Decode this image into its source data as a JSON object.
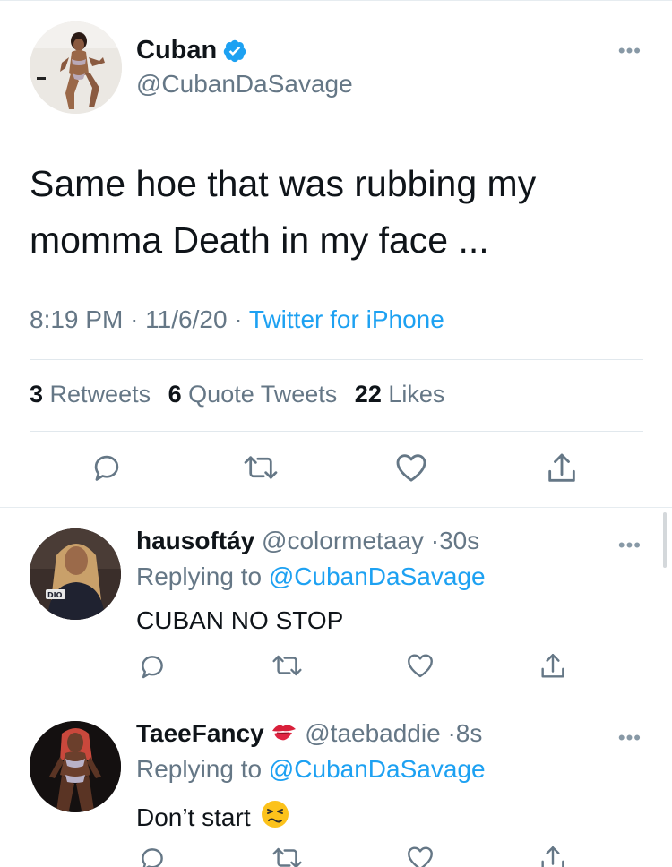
{
  "main_tweet": {
    "display_name": "Cuban",
    "handle": "@CubanDaSavage",
    "verified_icon": "verified-badge-icon",
    "text": "Same hoe that was rubbing my momma Death in my face ...",
    "time": "8:19 PM",
    "date": "11/6/20",
    "source": "Twitter for iPhone",
    "stats": {
      "retweets_count": "3",
      "retweets_label": "Retweets",
      "quotes_count": "6",
      "quotes_label": "Quote Tweets",
      "likes_count": "22",
      "likes_label": "Likes"
    },
    "actions": [
      "reply-icon",
      "retweet-icon",
      "like-icon",
      "share-icon"
    ]
  },
  "replies": [
    {
      "display_name": "hausoftáy",
      "handle": "@colormetaay",
      "time": "30s",
      "replying_prefix": "Replying to",
      "replying_to": "@CubanDaSavage",
      "text": "CUBAN NO STOP"
    },
    {
      "display_name": "TaeeFancy",
      "name_emoji": "kiss-mark-emoji",
      "handle": "@taebaddie",
      "time": "8s",
      "replying_prefix": "Replying to",
      "replying_to": "@CubanDaSavage",
      "text": "Don’t start",
      "text_emoji": "persevering-face-emoji"
    }
  ],
  "colors": {
    "link_blue": "#1da1f2",
    "secondary_text": "#657786",
    "primary_text": "#0f1419",
    "divider": "#e6ecf0"
  }
}
